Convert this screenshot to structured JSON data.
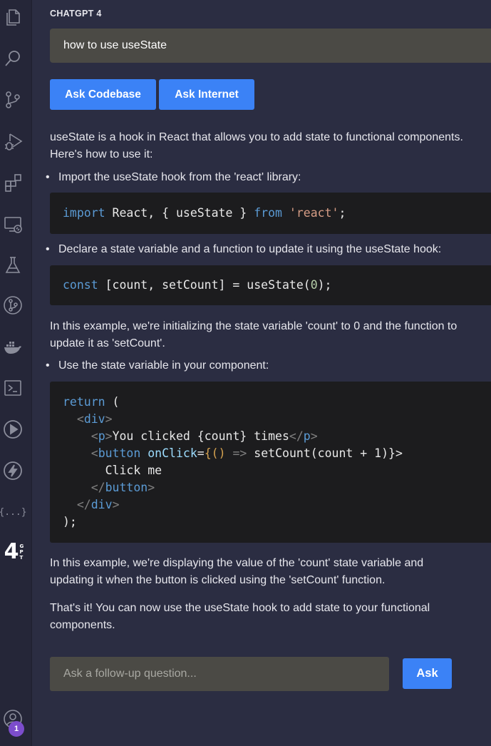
{
  "activity_bar": {
    "items": [
      {
        "name": "explorer-icon"
      },
      {
        "name": "search-icon"
      },
      {
        "name": "source-control-icon"
      },
      {
        "name": "run-debug-icon"
      },
      {
        "name": "extensions-icon"
      },
      {
        "name": "remote-explorer-icon"
      },
      {
        "name": "testing-icon"
      },
      {
        "name": "git-graph-icon"
      },
      {
        "name": "docker-icon"
      },
      {
        "name": "terminal-icon"
      },
      {
        "name": "play-icon"
      },
      {
        "name": "thunder-icon"
      },
      {
        "name": "json-braces-icon"
      },
      {
        "name": "chatgpt4-icon"
      }
    ],
    "json_icon_text": "{...}",
    "gpt_logo_number": "4",
    "gpt_logo_letters": "GPT",
    "account_badge": "1"
  },
  "panel": {
    "title": "CHATGPT 4",
    "query": "how to use useState",
    "ask_codebase_label": "Ask Codebase",
    "ask_internet_label": "Ask Internet",
    "intro_line1": "useState is a hook in React that allows you to add state to functional components.",
    "intro_line2": "Here's how to use it:",
    "bullet1": "Import the useState hook from the 'react' library:",
    "bullet2": "Declare a state variable and a function to update it using the useState hook:",
    "example1_line1": "In this example, we're initializing the state variable 'count' to 0 and the function to",
    "example1_line2": "update it as 'setCount'.",
    "bullet3": "Use the state variable in your component:",
    "example2_line1": "In this example, we're displaying the value of the 'count' state variable and",
    "example2_line2": "updating it when the button is clicked using the 'setCount' function.",
    "outro_line1": "That's it! You can now use the useState hook to add state to your functional",
    "outro_line2": "components.",
    "followup_placeholder": "Ask a follow-up question...",
    "ask_label": "Ask"
  },
  "code": {
    "import": {
      "kw": "import",
      "middle": " React, { useState } ",
      "from": "from",
      "sp": " ",
      "str": "'react'",
      "end": ";"
    },
    "declare": {
      "kw": "const",
      "middle": " [count, setCount] = useState(",
      "num": "0",
      "end": ");"
    },
    "jsx": {
      "l1_kw": "return",
      "l1_rest": " (",
      "l2_indent": "  ",
      "l2_open": "<",
      "l2_tag": "div",
      "l2_close": ">",
      "l3_indent": "    ",
      "l3_open": "<",
      "l3_tag": "p",
      "l3_close": ">",
      "l3_text": "You clicked {count} times",
      "l3_end_open": "</",
      "l3_end_tag": "p",
      "l3_end_close": ">",
      "l4_indent": "    ",
      "l4_open": "<",
      "l4_tag": "button",
      "l4_sp": " ",
      "l4_attr": "onClick",
      "l4_eq": "=",
      "l4_brace": "{",
      "l4_parens": "()",
      "l4_arrow": " =>",
      "l4_rest": " setCount(count + 1)}>",
      "l5_text": "      Click me",
      "l6_indent": "    ",
      "l6_open": "</",
      "l6_tag": "button",
      "l6_close": ">",
      "l7_indent": "  ",
      "l7_open": "</",
      "l7_tag": "div",
      "l7_close": ">",
      "l8_text": ");"
    }
  },
  "colors": {
    "accent": "#3b82f6",
    "panel_bg": "#2b2d42",
    "input_bg": "#4b4a45",
    "code_bg": "#1c1c1e",
    "badge": "#7c4dcc"
  }
}
